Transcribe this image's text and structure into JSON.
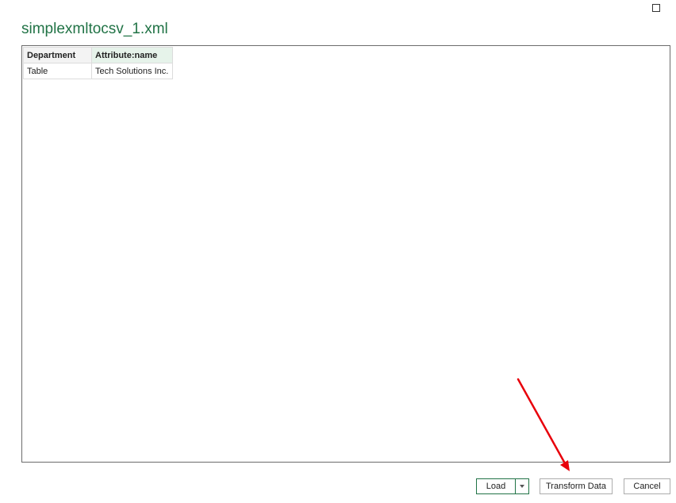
{
  "dialog": {
    "title": "simplexmltocsv_1.xml"
  },
  "table": {
    "headers": [
      "Department",
      "Attribute:name"
    ],
    "rows": [
      [
        "Table",
        "Tech Solutions Inc."
      ]
    ]
  },
  "buttons": {
    "load": "Load",
    "transform": "Transform Data",
    "cancel": "Cancel"
  },
  "colors": {
    "title": "#217346",
    "highlight_header": "#e6f3ea",
    "annotation_arrow": "#e8000b"
  }
}
